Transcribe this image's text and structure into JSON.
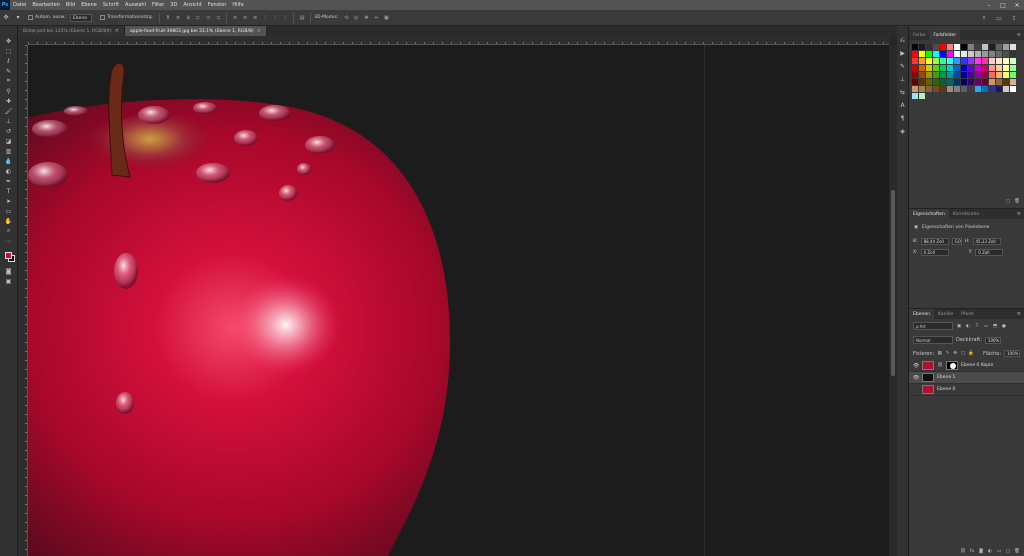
{
  "menubar": {
    "logo": "Ps",
    "items": [
      "Datei",
      "Bearbeiten",
      "Bild",
      "Ebene",
      "Schrift",
      "Auswahl",
      "Filter",
      "3D",
      "Ansicht",
      "Fenster",
      "Hilfe"
    ],
    "window_controls": [
      "–",
      "□",
      "✕"
    ]
  },
  "options": {
    "auto_select_label": "Autom. ausw.:",
    "auto_select_value": "Ebene",
    "transform_label": "Transformationsstrg.",
    "mode_3d_label": "3D-Modus:"
  },
  "tabs": [
    {
      "label": "Bilder.psd bei 133% (Ebene 1, RGB/8#)",
      "active": false
    },
    {
      "label": "apple-food-fruit-39803.jpg bei 33,1% (Ebene 1, RGB/8)",
      "active": true
    }
  ],
  "swatches_panel": {
    "tabs": [
      "Farbe",
      "Farbfelder"
    ],
    "active_tab": "Farbfelder",
    "colors": [
      "#000000",
      "#1a1a1a",
      "#333333",
      "#4d4d4d",
      "#ff0000",
      "#ff8080",
      "#ffffff",
      "#000000",
      "#808080",
      "#404040",
      "#c0c0c0",
      "#202020",
      "#606060",
      "#a0a0a0",
      "#e0e0e0",
      "#ff0000",
      "#ffff00",
      "#00ff00",
      "#00ffff",
      "#0000ff",
      "#ff00ff",
      "#ffffff",
      "#e6e6e6",
      "#cccccc",
      "#b3b3b3",
      "#999999",
      "#808080",
      "#666666",
      "#4d4d4d",
      "#333333",
      "#ff3333",
      "#ff9933",
      "#ffff33",
      "#99ff33",
      "#33ff99",
      "#33ffff",
      "#3399ff",
      "#3333ff",
      "#9933ff",
      "#ff33ff",
      "#ff3399",
      "#ffcccc",
      "#ffe5cc",
      "#ffffcc",
      "#ccffcc",
      "#cc0000",
      "#cc6600",
      "#cccc00",
      "#66cc00",
      "#00cc66",
      "#00cccc",
      "#0066cc",
      "#0000cc",
      "#6600cc",
      "#cc00cc",
      "#cc0066",
      "#ff9999",
      "#ffcc99",
      "#ffff99",
      "#99ff99",
      "#990000",
      "#994c00",
      "#999900",
      "#4c9900",
      "#00994c",
      "#009999",
      "#004c99",
      "#000099",
      "#4c0099",
      "#990099",
      "#99004c",
      "#ff6666",
      "#ffb266",
      "#ffff66",
      "#66ff66",
      "#660000",
      "#663300",
      "#666600",
      "#336600",
      "#006633",
      "#006666",
      "#003366",
      "#000066",
      "#330066",
      "#660066",
      "#660033",
      "#cc9966",
      "#996633",
      "#663300",
      "#ccb399",
      "#c69c6d",
      "#a67c52",
      "#8c6239",
      "#754c24",
      "#603913",
      "#9e8e7e",
      "#7f7f7f",
      "#5e5e5e",
      "#3d3d3d",
      "#29abe2",
      "#0071bc",
      "#2e3192",
      "#1b1464",
      "#cccccc",
      "#ffffff",
      "#9fe1f5",
      "#b3f0b3"
    ]
  },
  "properties_panel": {
    "tabs": [
      "Eigenschaften",
      "Korrekturen"
    ],
    "active_tab": "Eigenschaften",
    "heading": "Eigenschaften von Pixelebene",
    "w_label": "B:",
    "w_value": "88,44 Zoll",
    "link_label": "GO",
    "h_label": "H:",
    "h_value": "45,23 Zoll",
    "x_label": "X:",
    "x_value": "0 Zoll",
    "y_label": "Y:",
    "y_value": "0 Zoll"
  },
  "layers_panel": {
    "tabs": [
      "Ebenen",
      "Kanäle",
      "Pfade"
    ],
    "active_tab": "Ebenen",
    "filter_label": "ρ Art",
    "blend_mode": "Normal",
    "opacity_label": "Deckkraft:",
    "opacity_value": "100%",
    "lock_label": "Fixieren:",
    "fill_label": "Fläche:",
    "fill_value": "100%",
    "layers": [
      {
        "name": "Ebene 0 Kopie",
        "visible": true,
        "selected": false,
        "thumb_color": "#b0102e",
        "has_mask": true
      },
      {
        "name": "Ebene 1",
        "visible": true,
        "selected": true,
        "thumb_color": "#101010",
        "has_mask": false
      },
      {
        "name": "Ebene 0",
        "visible": false,
        "selected": false,
        "thumb_color": "#b0102e",
        "has_mask": false
      }
    ]
  }
}
